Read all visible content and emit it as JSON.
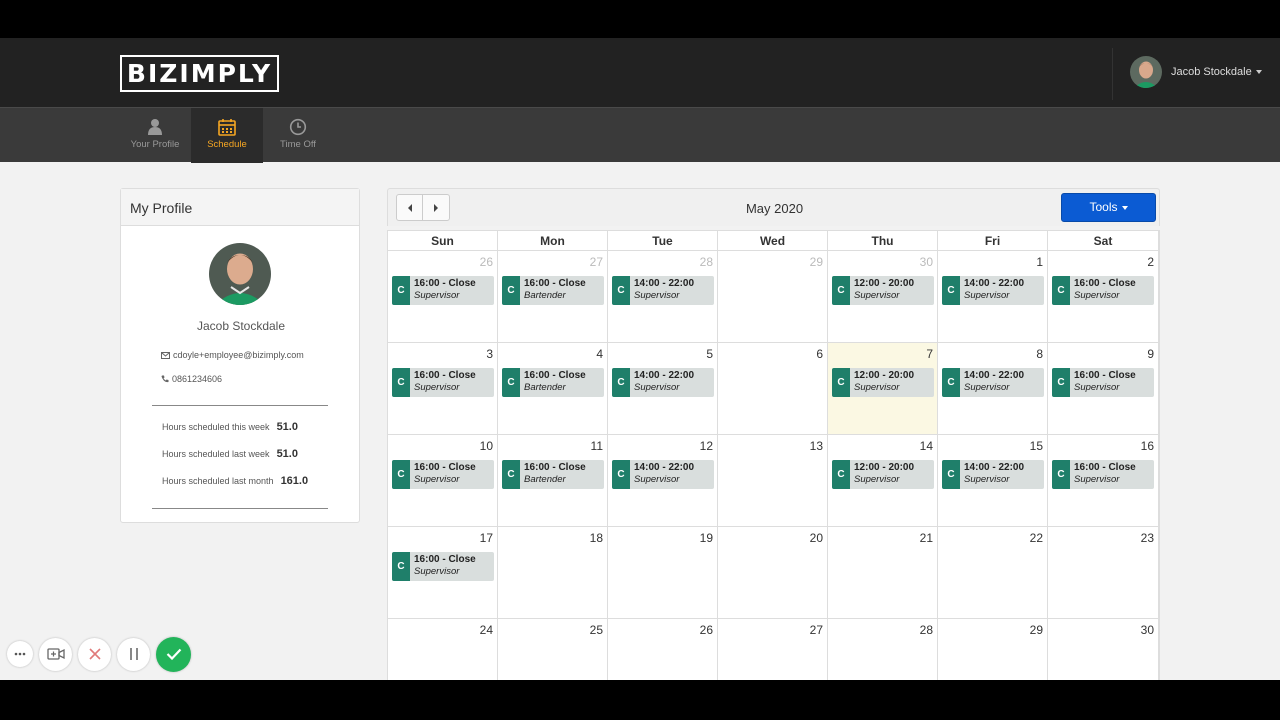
{
  "header": {
    "logo_text": "BIZIMPLY",
    "user_name": "Jacob Stockdale"
  },
  "nav": [
    {
      "label": "Your Profile",
      "icon": "person-icon",
      "active": false
    },
    {
      "label": "Schedule",
      "icon": "calendar-icon",
      "active": true
    },
    {
      "label": "Time Off",
      "icon": "clock-icon",
      "active": false
    }
  ],
  "profile": {
    "title": "My Profile",
    "name": "Jacob Stockdale",
    "email": "cdoyle+employee@bizimply.com",
    "phone": "0861234606",
    "stats": [
      {
        "label": "Hours scheduled this week",
        "value": "51.0"
      },
      {
        "label": "Hours scheduled last week",
        "value": "51.0"
      },
      {
        "label": "Hours scheduled last month",
        "value": "161.0"
      }
    ]
  },
  "calendar": {
    "month_label": "May 2020",
    "tools_label": "Tools",
    "weekdays": [
      "Sun",
      "Mon",
      "Tue",
      "Wed",
      "Thu",
      "Fri",
      "Sat"
    ],
    "weeks": [
      [
        {
          "day": "26",
          "other": true,
          "shift": {
            "time": "16:00 - Close",
            "role": "Supervisor"
          }
        },
        {
          "day": "27",
          "other": true,
          "shift": {
            "time": "16:00 - Close",
            "role": "Bartender"
          }
        },
        {
          "day": "28",
          "other": true,
          "shift": {
            "time": "14:00 - 22:00",
            "role": "Supervisor"
          }
        },
        {
          "day": "29",
          "other": true
        },
        {
          "day": "30",
          "other": true,
          "shift": {
            "time": "12:00 - 20:00",
            "role": "Supervisor"
          }
        },
        {
          "day": "1",
          "shift": {
            "time": "14:00 - 22:00",
            "role": "Supervisor"
          }
        },
        {
          "day": "2",
          "shift": {
            "time": "16:00 - Close",
            "role": "Supervisor"
          }
        }
      ],
      [
        {
          "day": "3",
          "shift": {
            "time": "16:00 - Close",
            "role": "Supervisor"
          }
        },
        {
          "day": "4",
          "shift": {
            "time": "16:00 - Close",
            "role": "Bartender"
          }
        },
        {
          "day": "5",
          "shift": {
            "time": "14:00 - 22:00",
            "role": "Supervisor"
          }
        },
        {
          "day": "6"
        },
        {
          "day": "7",
          "today": true,
          "shift": {
            "time": "12:00 - 20:00",
            "role": "Supervisor"
          }
        },
        {
          "day": "8",
          "shift": {
            "time": "14:00 - 22:00",
            "role": "Supervisor"
          }
        },
        {
          "day": "9",
          "shift": {
            "time": "16:00 - Close",
            "role": "Supervisor"
          }
        }
      ],
      [
        {
          "day": "10",
          "shift": {
            "time": "16:00 - Close",
            "role": "Supervisor"
          }
        },
        {
          "day": "11",
          "shift": {
            "time": "16:00 - Close",
            "role": "Bartender"
          }
        },
        {
          "day": "12",
          "shift": {
            "time": "14:00 - 22:00",
            "role": "Supervisor"
          }
        },
        {
          "day": "13"
        },
        {
          "day": "14",
          "shift": {
            "time": "12:00 - 20:00",
            "role": "Supervisor"
          }
        },
        {
          "day": "15",
          "shift": {
            "time": "14:00 - 22:00",
            "role": "Supervisor"
          }
        },
        {
          "day": "16",
          "shift": {
            "time": "16:00 - Close",
            "role": "Supervisor"
          }
        }
      ],
      [
        {
          "day": "17",
          "shift": {
            "time": "16:00 - Close",
            "role": "Supervisor"
          }
        },
        {
          "day": "18"
        },
        {
          "day": "19"
        },
        {
          "day": "20"
        },
        {
          "day": "21"
        },
        {
          "day": "22"
        },
        {
          "day": "23"
        }
      ],
      [
        {
          "day": "24"
        },
        {
          "day": "25"
        },
        {
          "day": "26"
        },
        {
          "day": "27"
        },
        {
          "day": "28"
        },
        {
          "day": "29"
        },
        {
          "day": "30"
        }
      ]
    ],
    "shift_tag": "C"
  },
  "recorder": {
    "buttons": [
      "more-icon",
      "camera-icon",
      "close-icon",
      "pause-icon",
      "check-icon"
    ]
  },
  "colors": {
    "accent": "#f5a623",
    "tools_blue": "#0b5bd3",
    "shift_teal": "#1f7f6a",
    "today_bg": "#fbf8e3",
    "confirm_green": "#22b45a"
  }
}
